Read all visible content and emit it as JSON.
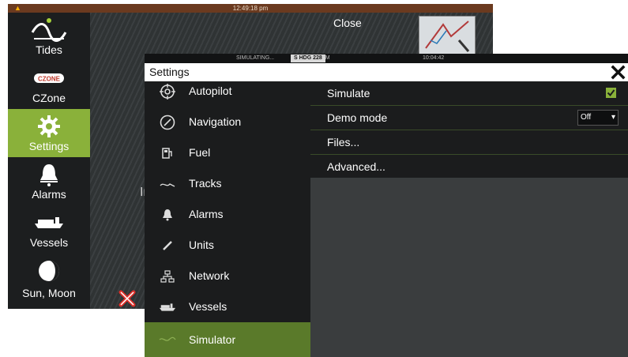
{
  "background_screen": {
    "clock": "12:49:18 pm",
    "warning_icon": "warning-icon",
    "sidebar": [
      {
        "label": "Tides",
        "icon": "tides-icon"
      },
      {
        "label": "CZone",
        "icon": "czone-icon"
      },
      {
        "label": "Settings",
        "icon": "gear-icon",
        "active": true
      },
      {
        "label": "Alarms",
        "icon": "bell-icon"
      },
      {
        "label": "Vessels",
        "icon": "vessels-icon"
      },
      {
        "label": "Sun, Moon",
        "icon": "moon-icon"
      }
    ],
    "close_label": "Close",
    "partial_text": "Ir"
  },
  "status_bar": {
    "simulating": "SIMULATING...",
    "heading_label": "S",
    "heading_text": "HDG",
    "heading_value": "228",
    "heading_unit": "°M",
    "time": "10:04:42"
  },
  "dialog": {
    "title": "Settings",
    "close_icon": "close-icon",
    "menu": [
      {
        "label": "Autopilot",
        "icon": "autopilot-icon"
      },
      {
        "label": "Navigation",
        "icon": "compass-icon"
      },
      {
        "label": "Fuel",
        "icon": "fuel-icon"
      },
      {
        "label": "Tracks",
        "icon": "tracks-icon"
      },
      {
        "label": "Alarms",
        "icon": "bell-icon"
      },
      {
        "label": "Units",
        "icon": "pencil-icon"
      },
      {
        "label": "Network",
        "icon": "network-icon"
      },
      {
        "label": "Vessels",
        "icon": "vessels-icon"
      },
      {
        "label": "Simulator",
        "icon": "simulator-icon",
        "active": true
      }
    ],
    "settings": {
      "simulate_label": "Simulate",
      "simulate_checked": true,
      "demo_mode_label": "Demo mode",
      "demo_mode_value": "Off",
      "files_label": "Files...",
      "advanced_label": "Advanced..."
    }
  },
  "colors": {
    "accent": "#8ab13a",
    "menu_active": "#5a7a2a",
    "topbar": "#6b3a1f"
  }
}
